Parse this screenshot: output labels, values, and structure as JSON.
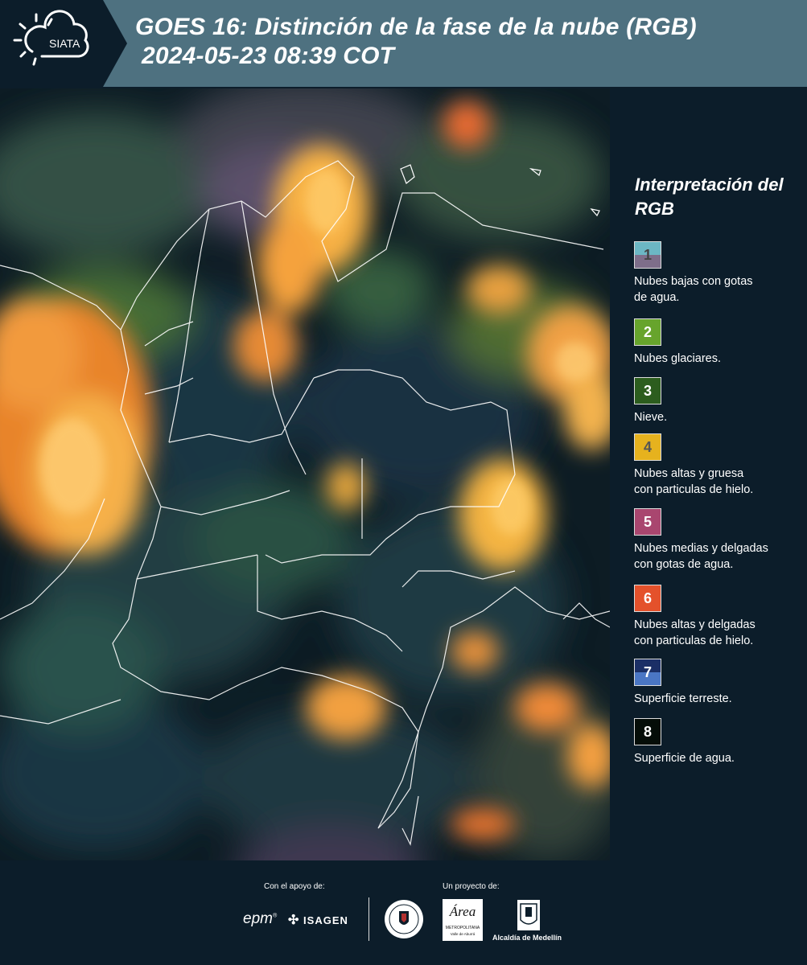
{
  "header": {
    "logo_text": "SIATA",
    "title_line1": "GOES 16: Distinción de la fase de la nube (RGB)",
    "title_line2": "2024-05-23 08:39 COT"
  },
  "legend": {
    "title": "Interpretación del RGB",
    "items": [
      {
        "number": "1",
        "label_lines": [
          "Nubes bajas con gotas",
          "de agua."
        ],
        "color_top": "#6cb7c4",
        "color_bottom": "#7e6e8a",
        "number_color": "#444"
      },
      {
        "number": "2",
        "label_lines": [
          "Nubes glaciares."
        ],
        "color_top": "#67a42c",
        "color_bottom": "#67a42c",
        "number_color": "#fff"
      },
      {
        "number": "3",
        "label_lines": [
          "Nieve."
        ],
        "color_top": "#2c5d1e",
        "color_bottom": "#2c5d1e",
        "number_color": "#fff"
      },
      {
        "number": "4",
        "label_lines": [
          "Nubes altas y gruesa",
          "con particulas de hielo."
        ],
        "color_top": "#e6b21e",
        "color_bottom": "#e6b21e",
        "number_color": "#555"
      },
      {
        "number": "5",
        "label_lines": [
          "Nubes medias y delgadas",
          "con gotas de agua."
        ],
        "color_top": "#a9466f",
        "color_bottom": "#a9466f",
        "number_color": "#fff"
      },
      {
        "number": "6",
        "label_lines": [
          "Nubes altas y delgadas",
          "con particulas de hielo."
        ],
        "color_top": "#e4512b",
        "color_bottom": "#e4512b",
        "number_color": "#fff"
      },
      {
        "number": "7",
        "label_lines": [
          "Superficie terreste."
        ],
        "color_top": "#1b2f66",
        "color_bottom": "#4a76c4",
        "number_color": "#fff"
      },
      {
        "number": "8",
        "label_lines": [
          "Superficie de agua."
        ],
        "color_top": "#050d08",
        "color_bottom": "#050d08",
        "number_color": "#fff"
      }
    ]
  },
  "footer": {
    "support_label": "Con el apoyo de:",
    "project_label": "Un proyecto de:",
    "sponsor1": "epm",
    "sponsor2": "ISAGEN",
    "partner_area": "Área",
    "partner_area_sub1": "METROPOLITANA",
    "partner_area_sub2": "Valle de Aburrá",
    "partner_alcaldia": "Alcaldía de Medellín"
  }
}
